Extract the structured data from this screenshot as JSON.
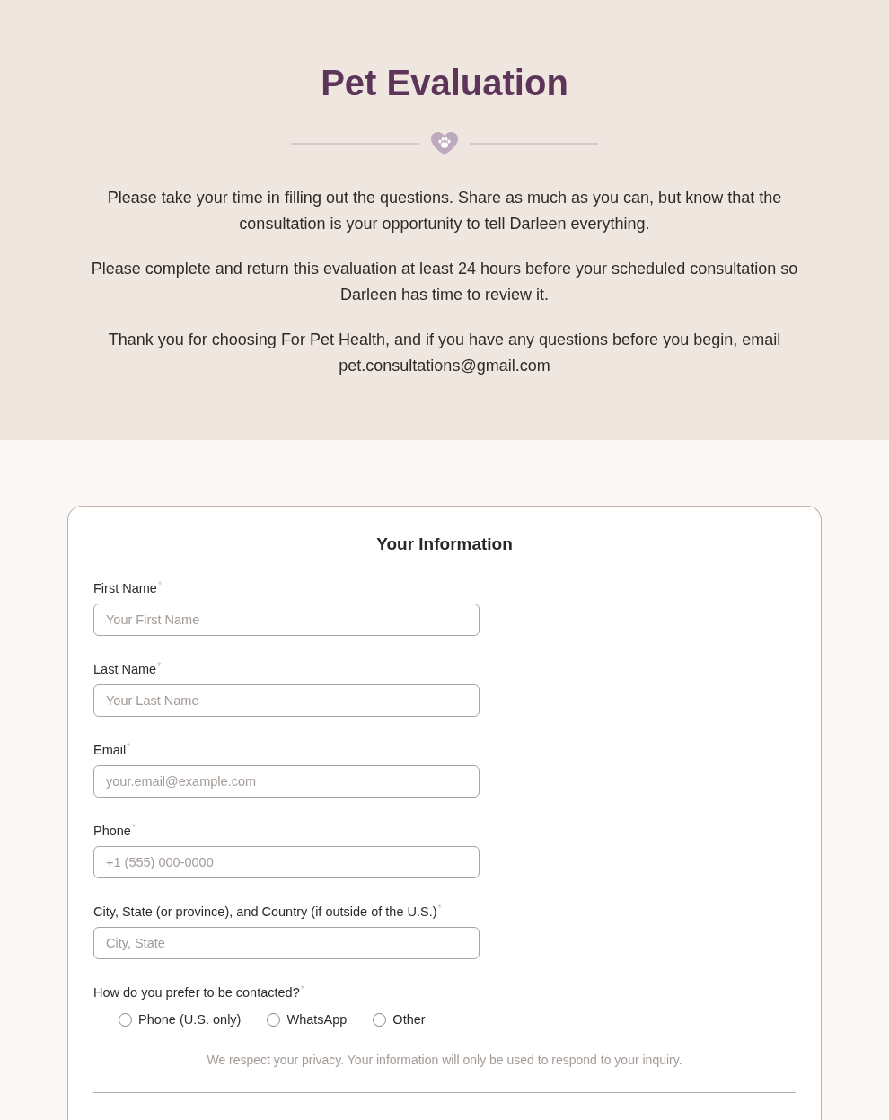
{
  "header": {
    "title": "Pet Evaluation",
    "paragraphs": [
      "Please take your time in filling out the questions. Share as much as you can, but know that the consultation is your opportunity to tell Darleen everything.",
      "Please complete and return this evaluation at least 24 hours before your scheduled consultation so Darleen has time to review it.",
      "Thank you for choosing For Pet Health, and if you have any questions before you begin, email pet.consultations@gmail.com"
    ]
  },
  "form": {
    "section_title": "Your Information",
    "fields": [
      {
        "label": "First Name",
        "required_mark": "*",
        "placeholder": "Your First Name"
      },
      {
        "label": "Last Name",
        "required_mark": "*",
        "placeholder": "Your Last Name"
      },
      {
        "label": "Email",
        "required_mark": "*",
        "placeholder": "your.email@example.com"
      },
      {
        "label": "Phone",
        "required_mark": "*",
        "placeholder": "+1 (555) 000-0000"
      },
      {
        "label": "City, State (or province), and Country (if outside of the U.S.)",
        "required_mark": "*",
        "placeholder": "City, State"
      }
    ],
    "contact": {
      "label": "How do you prefer to be contacted?",
      "required_mark": "*",
      "options": [
        {
          "label": "Phone (U.S. only)",
          "selected": false
        },
        {
          "label": "WhatsApp",
          "selected": false
        },
        {
          "label": "Other",
          "selected": false
        }
      ]
    },
    "privacy_note": "We respect your privacy. Your information will only be used to respond to your inquiry."
  }
}
